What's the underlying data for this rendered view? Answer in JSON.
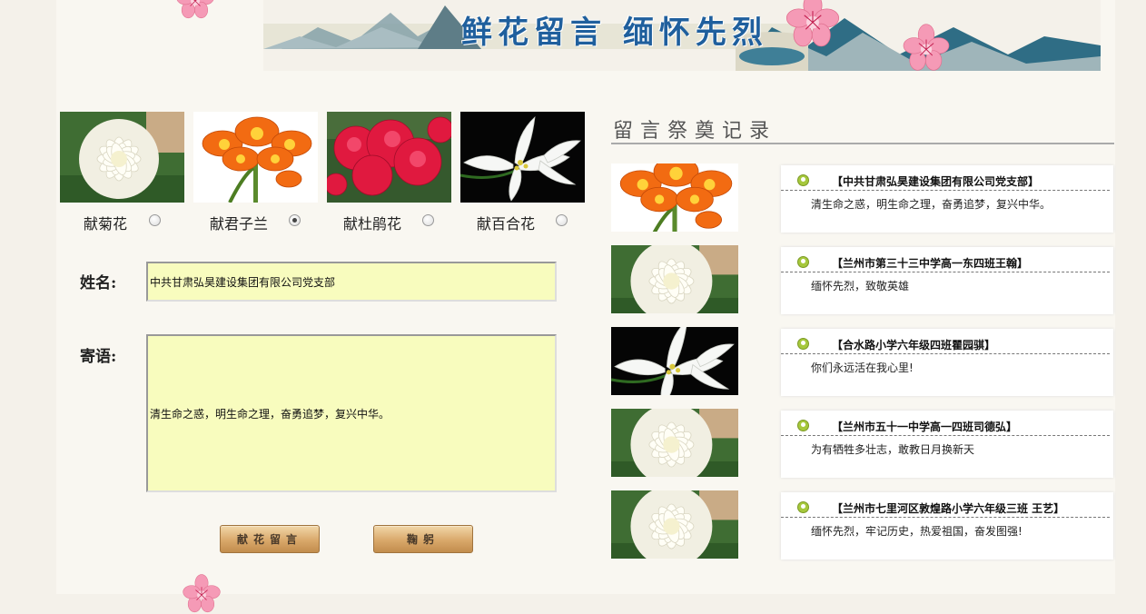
{
  "banner": {
    "title": "鲜花留言  缅怀先烈"
  },
  "flowers": [
    {
      "label": "献菊花",
      "icon": "chrysanthemum-image",
      "checked": false
    },
    {
      "label": "献君子兰",
      "icon": "clivia-image",
      "checked": true
    },
    {
      "label": "献杜鹃花",
      "icon": "azalea-image",
      "checked": false
    },
    {
      "label": "献百合花",
      "icon": "lily-image",
      "checked": false
    }
  ],
  "form": {
    "name_label": "姓名:",
    "name_value": "中共甘肃弘昊建设集团有限公司党支部",
    "message_label": "寄语:",
    "message_value": "清生命之惑，明生命之理，奋勇追梦，复兴中华。",
    "submit_label": "献花留言",
    "bow_label": "鞠躬"
  },
  "records": {
    "title": "留言祭奠记录",
    "items": [
      {
        "flower": "clivia-image",
        "name": "【中共甘肃弘昊建设集团有限公司党支部】",
        "message": "清生命之惑，明生命之理，奋勇追梦，复兴中华。"
      },
      {
        "flower": "chrysanthemum-image",
        "name": "【兰州市第三十三中学高一东四班王翰】",
        "message": "缅怀先烈，致敬英雄"
      },
      {
        "flower": "lily-image",
        "name": "【合水路小学六年级四班瞿园骐】",
        "message": "你们永远活在我心里!"
      },
      {
        "flower": "chrysanthemum-image",
        "name": "【兰州市五十一中学高一四班司德弘】",
        "message": "为有牺牲多壮志，敢教日月换新天"
      },
      {
        "flower": "chrysanthemum-image",
        "name": "【兰州市七里河区敦煌路小学六年级三班  王艺】",
        "message": "缅怀先烈，牢记历史，热爱祖国，奋发图强!"
      }
    ]
  },
  "colors": {
    "field_bg": "#f8fcbe",
    "title_blue": "#1f5f9d",
    "button_gold": "#d9a86a",
    "icon_green": "#a6c83c"
  }
}
